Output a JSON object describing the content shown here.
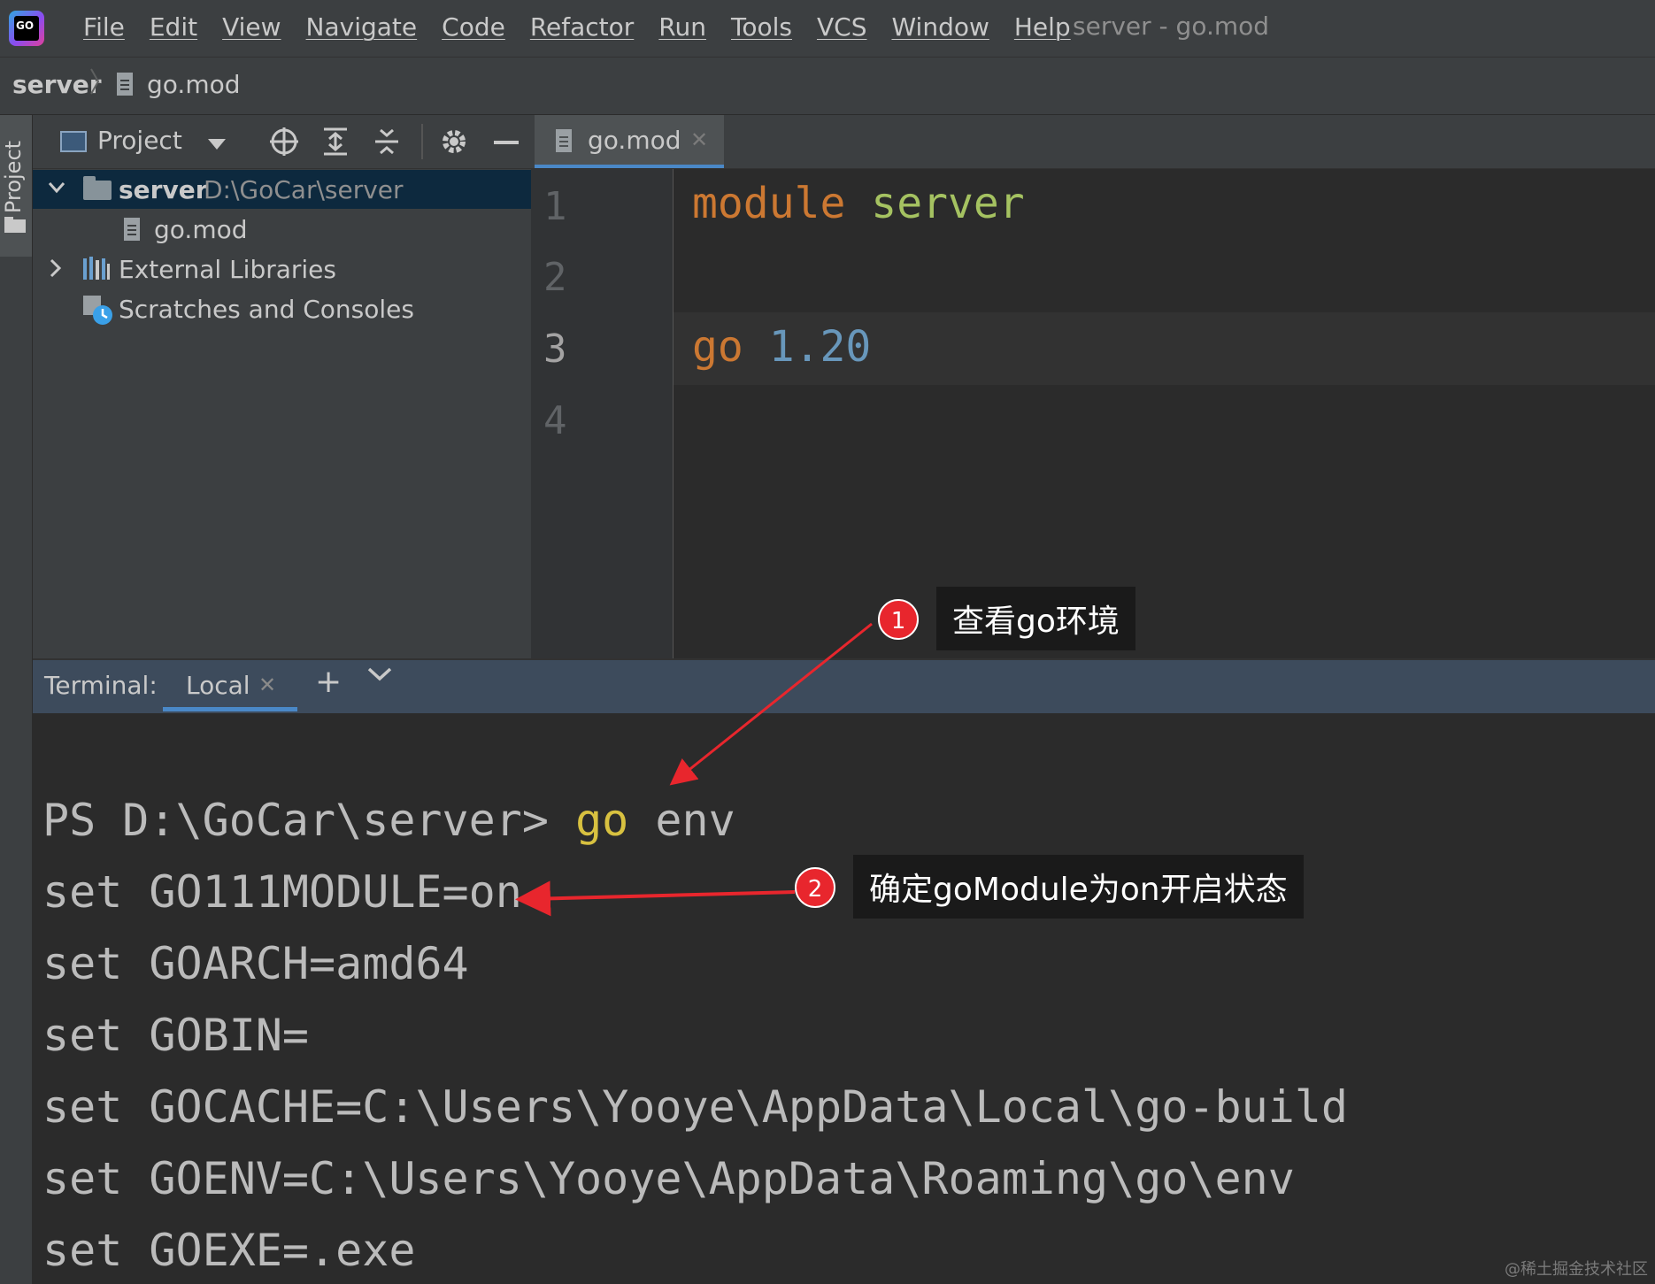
{
  "app": {
    "logo_text": "GO",
    "window_title": "server - go.mod"
  },
  "menu": [
    "File",
    "Edit",
    "View",
    "Navigate",
    "Code",
    "Refactor",
    "Run",
    "Tools",
    "VCS",
    "Window",
    "Help"
  ],
  "breadcrumb": {
    "project": "server",
    "file": "go.mod"
  },
  "left_strip": {
    "project_label": "Project"
  },
  "project_panel": {
    "title": "Project",
    "tree": [
      {
        "label": "server",
        "path": "D:\\GoCar\\server"
      },
      {
        "label": "go.mod"
      },
      {
        "label": "External Libraries"
      },
      {
        "label": "Scratches and Consoles"
      }
    ]
  },
  "editor": {
    "tab_label": "go.mod",
    "line_numbers": [
      "1",
      "2",
      "3",
      "4"
    ],
    "code": {
      "line1_kw": "module",
      "line1_name": "server",
      "line3_kw": "go",
      "line3_ver": "1.20"
    }
  },
  "terminal": {
    "label": "Terminal:",
    "tab_label": "Local",
    "prompt": "PS D:\\GoCar\\server> ",
    "command_go": "go",
    "command_rest": " env",
    "lines": [
      "set GO111MODULE=on",
      "set GOARCH=amd64",
      "set GOBIN=",
      "set GOCACHE=C:\\Users\\Yooye\\AppData\\Local\\go-build",
      "set GOENV=C:\\Users\\Yooye\\AppData\\Roaming\\go\\env",
      "set GOEXE=.exe"
    ]
  },
  "annotations": [
    {
      "number": "1",
      "text": "查看go环境"
    },
    {
      "number": "2",
      "text": "确定goModule为on开启状态"
    }
  ],
  "watermark": "@稀土掘金技术社区",
  "colors": {
    "accent": "#4a88c7",
    "badge": "#e8262d",
    "arrow": "#e8262d"
  }
}
